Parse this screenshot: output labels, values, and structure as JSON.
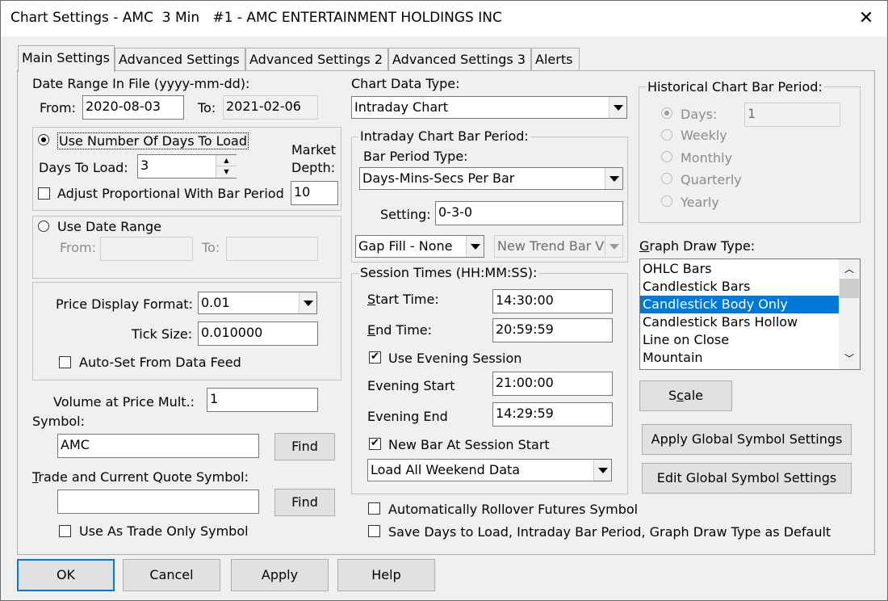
{
  "window": {
    "title": "Chart Settings - AMC  3 Min   #1 - AMC ENTERTAINMENT HOLDINGS INC",
    "close_icon": "close-icon"
  },
  "tabs": [
    "Main Settings",
    "Advanced Settings",
    "Advanced Settings 2",
    "Advanced Settings 3",
    "Alerts"
  ],
  "date_range": {
    "label": "Date Range In File (yyyy-mm-dd):",
    "from_label": "From:",
    "from_value": "2020-08-03",
    "to_label": "To:",
    "to_value": "2021-02-06"
  },
  "days": {
    "use_days_label": "Use Number Of Days To Load",
    "days_label": "Days To Load:",
    "days_value": "3",
    "market_depth_label_1": "Market",
    "market_depth_label_2": "Depth:",
    "market_depth_value": "10",
    "adjust_label": "Adjust Proportional With Bar Period"
  },
  "date_range_opt": {
    "label": "Use Date Range",
    "from_label": "From:",
    "to_label": "To:",
    "from_value": "",
    "to_value": ""
  },
  "price": {
    "format_label": "Price Display Format:",
    "format_value": "0.01",
    "tick_label": "Tick Size:",
    "tick_value": "0.010000",
    "auto_label": "Auto-Set From Data Feed"
  },
  "volume": {
    "label": "Volume at Price Mult.:",
    "value": "1"
  },
  "symbol": {
    "label": "Symbol:",
    "value": "AMC",
    "find_label": "Find"
  },
  "trade_symbol": {
    "label": "Trade and Current Quote Symbol:",
    "value": "",
    "find_label": "Find",
    "trade_only_label": "Use As Trade Only Symbol"
  },
  "chart_data_type": {
    "label": "Chart Data Type:",
    "value": "Intraday Chart"
  },
  "intraday": {
    "group_label": "Intraday Chart Bar Period:",
    "bar_type_label": "Bar Period Type:",
    "bar_type_value": "Days-Mins-Secs Per Bar",
    "setting_label": "Setting:",
    "setting_value": "0-3-0",
    "gap_fill_value": "Gap Fill - None",
    "new_trend_value": "New Trend Bar V"
  },
  "session": {
    "group_label": "Session Times (HH:MM:SS):",
    "start_label": "Start Time:",
    "start_value": "14:30:00",
    "end_label": "End Time:",
    "end_value": "20:59:59",
    "use_evening_label": "Use Evening Session",
    "evening_start_label": "Evening Start",
    "evening_start_value": "21:00:00",
    "evening_end_label": "Evening End",
    "evening_end_value": "14:29:59",
    "new_bar_label": "New Bar At Session Start",
    "weekend_value": "Load All Weekend Data"
  },
  "historical": {
    "group_label": "Historical Chart Bar Period:",
    "days_label": "Days:",
    "days_value": "1",
    "weekly": "Weekly",
    "monthly": "Monthly",
    "quarterly": "Quarterly",
    "yearly": "Yearly"
  },
  "graph": {
    "label": "Graph Draw Type:",
    "items": [
      "OHLC Bars",
      "Candlestick Bars",
      "Candlestick Body Only",
      "Candlestick Bars Hollow",
      "Line on Close",
      "Mountain"
    ],
    "selected": "Candlestick Body Only"
  },
  "buttons": {
    "scale": "Scale",
    "apply_global": "Apply Global Symbol Settings",
    "edit_global": "Edit Global Symbol Settings",
    "ok": "OK",
    "cancel": "Cancel",
    "apply": "Apply",
    "help": "Help"
  },
  "options": {
    "rollover": "Automatically Rollover Futures Symbol",
    "save_default": "Save Days to Load, Intraday Bar Period, Graph Draw Type as Default"
  },
  "colors": {
    "selection": "#0078d7",
    "window_bg": "#f0f0f0"
  }
}
